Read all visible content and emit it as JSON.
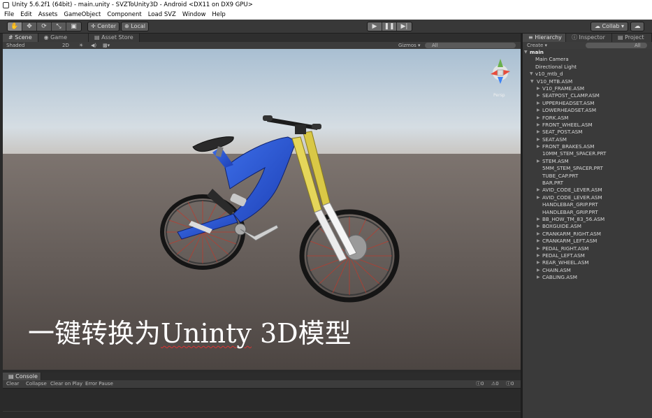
{
  "window": {
    "title": "Unity 5.6.2f1 (64bit) - main.unity - SVZToUnity3D - Android <DX11 on DX9 GPU>"
  },
  "menu": [
    "File",
    "Edit",
    "Assets",
    "GameObject",
    "Component",
    "Load SVZ",
    "Window",
    "Help"
  ],
  "toolbar": {
    "tools": [
      "hand-tool",
      "move-tool",
      "rotate-tool",
      "scale-tool",
      "rect-tool"
    ],
    "pivot_center": "Center",
    "pivot_local": "Local",
    "collab": "Collab ▾"
  },
  "tabs": {
    "scene": "Scene",
    "game": "Game",
    "asset_store": "Asset Store"
  },
  "scene_toolbar": {
    "shading": "Shaded",
    "mode_2d": "2D",
    "gizmos": "Gizmos ▾",
    "search": "All"
  },
  "gizmo": {
    "label": "Persp"
  },
  "overlay": {
    "part1": "一键转换为",
    "part2": "Uninty",
    "part3": " 3D模型"
  },
  "console": {
    "tab": "Console",
    "buttons": [
      "Clear",
      "Collapse",
      "Clear on Play",
      "Error Pause"
    ],
    "counts": {
      "info": "0",
      "warn": "0",
      "error": "0"
    }
  },
  "panels": {
    "hierarchy": "Hierarchy",
    "inspector": "Inspector",
    "project": "Project",
    "create": "Create ▾",
    "search": "All"
  },
  "hierarchy": [
    {
      "name": "main",
      "indent": 0,
      "arrow": "▼",
      "bold": true
    },
    {
      "name": "Main Camera",
      "indent": 1,
      "arrow": ""
    },
    {
      "name": "Directional Light",
      "indent": 1,
      "arrow": ""
    },
    {
      "name": "v10_mtb_d",
      "indent": 1,
      "arrow": "▼"
    },
    {
      "name": "V10_MTB.ASM",
      "indent": 2,
      "arrow": "▼"
    },
    {
      "name": "V10_FRAME.ASM",
      "indent": 3,
      "arrow": "▶"
    },
    {
      "name": "SEATPOST_CLAMP.ASM",
      "indent": 3,
      "arrow": "▶"
    },
    {
      "name": "UPPERHEADSET.ASM",
      "indent": 3,
      "arrow": "▶"
    },
    {
      "name": "LOWERHEADSET.ASM",
      "indent": 3,
      "arrow": "▶"
    },
    {
      "name": "FORK.ASM",
      "indent": 3,
      "arrow": "▶"
    },
    {
      "name": "FRONT_WHEEL.ASM",
      "indent": 3,
      "arrow": "▶"
    },
    {
      "name": "SEAT_POST.ASM",
      "indent": 3,
      "arrow": "▶"
    },
    {
      "name": "SEAT.ASM",
      "indent": 3,
      "arrow": "▶"
    },
    {
      "name": "FRONT_BRAKES.ASM",
      "indent": 3,
      "arrow": "▶"
    },
    {
      "name": "10MM_STEM_SPACER.PRT",
      "indent": 3,
      "arrow": ""
    },
    {
      "name": "STEM.ASM",
      "indent": 3,
      "arrow": "▶"
    },
    {
      "name": "5MM_STEM_SPACER.PRT",
      "indent": 3,
      "arrow": ""
    },
    {
      "name": "TUBE_CAP.PRT",
      "indent": 3,
      "arrow": ""
    },
    {
      "name": "BAR.PRT",
      "indent": 3,
      "arrow": ""
    },
    {
      "name": "AVID_CODE_LEVER.ASM",
      "indent": 3,
      "arrow": "▶"
    },
    {
      "name": "AVID_CODE_LEVER.ASM",
      "indent": 3,
      "arrow": "▶"
    },
    {
      "name": "HANDLEBAR_GRIP.PRT",
      "indent": 3,
      "arrow": ""
    },
    {
      "name": "HANDLEBAR_GRIP.PRT",
      "indent": 3,
      "arrow": ""
    },
    {
      "name": "BB_HOW_TM_83_56.ASM",
      "indent": 3,
      "arrow": "▶"
    },
    {
      "name": "BOXGUIDE.ASM",
      "indent": 3,
      "arrow": "▶"
    },
    {
      "name": "CRANKARM_RIGHT.ASM",
      "indent": 3,
      "arrow": "▶"
    },
    {
      "name": "CRANKARM_LEFT.ASM",
      "indent": 3,
      "arrow": "▶"
    },
    {
      "name": "PEDAL_RIGHT.ASM",
      "indent": 3,
      "arrow": "▶"
    },
    {
      "name": "PEDAL_LEFT.ASM",
      "indent": 3,
      "arrow": "▶"
    },
    {
      "name": "REAR_WHEEL.ASM",
      "indent": 3,
      "arrow": "▶"
    },
    {
      "name": "CHAIN.ASM",
      "indent": 3,
      "arrow": "▶"
    },
    {
      "name": "CABLING.ASM",
      "indent": 3,
      "arrow": "▶"
    }
  ]
}
